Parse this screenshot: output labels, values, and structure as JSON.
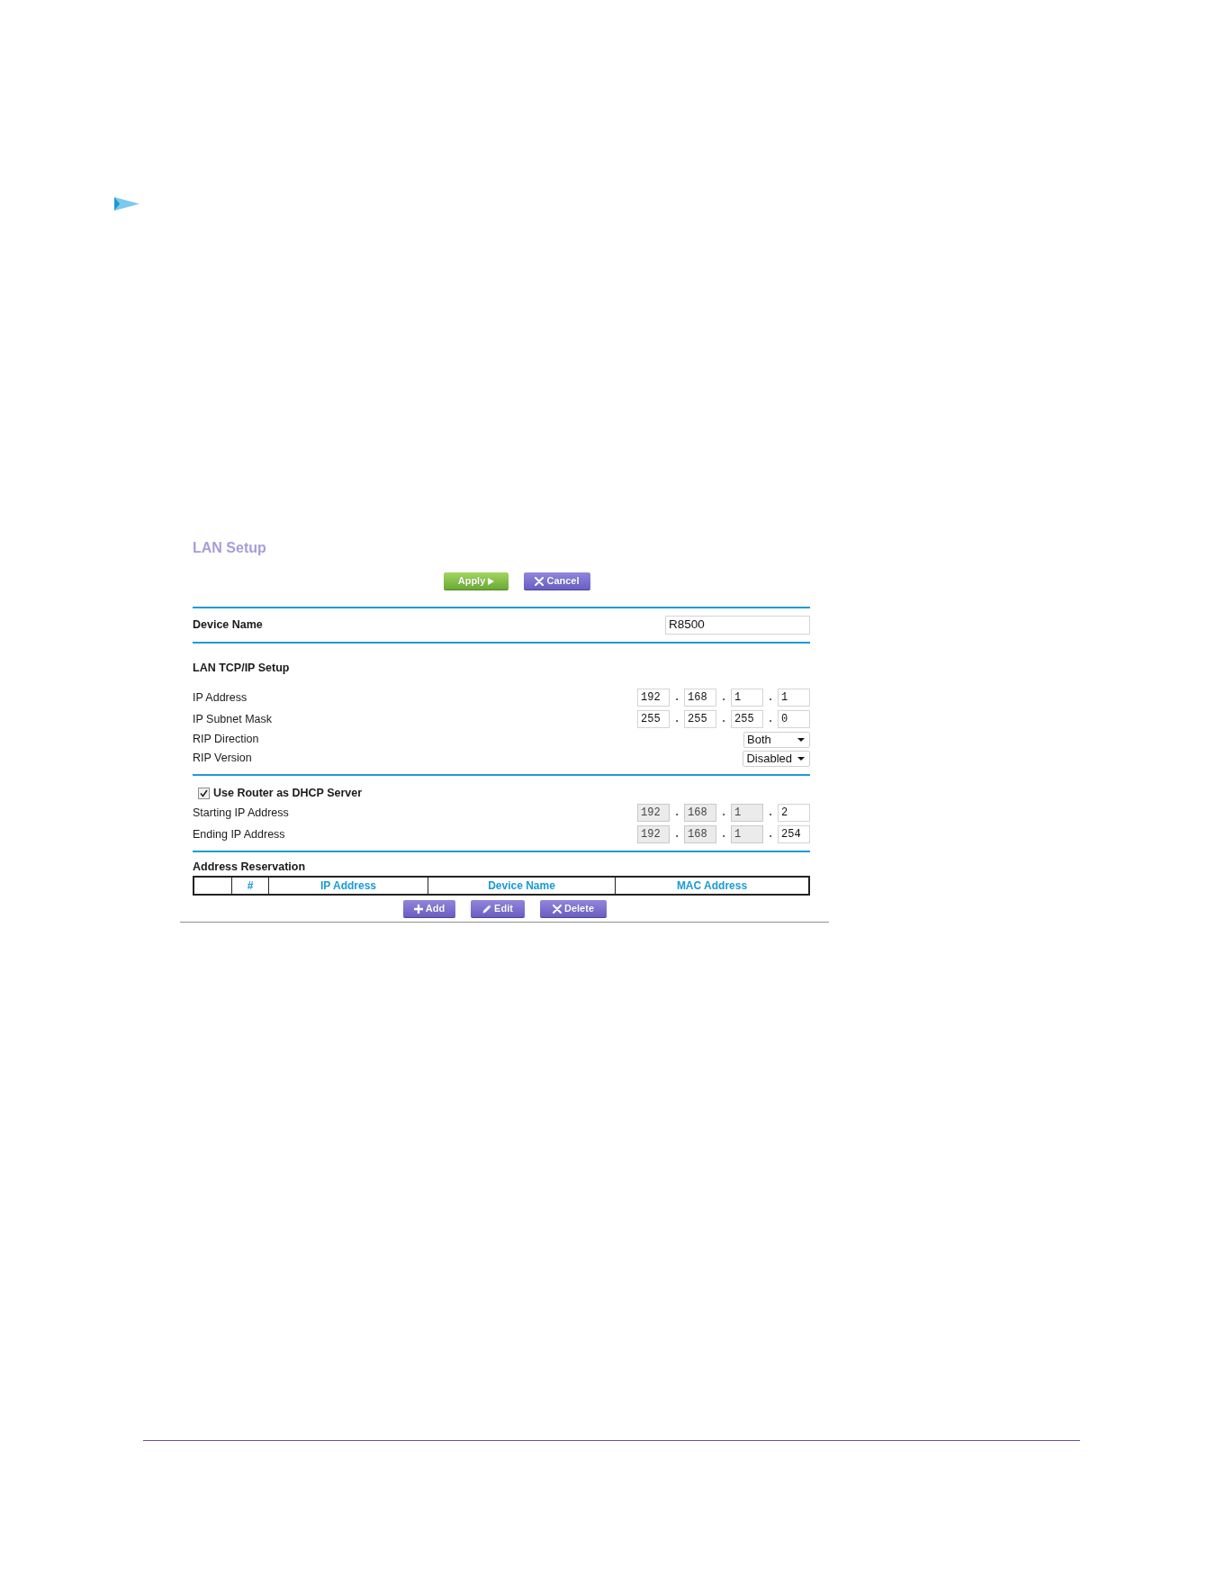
{
  "panel": {
    "title": "LAN Setup",
    "buttons": [
      {
        "kind": "apply",
        "label": "Apply"
      },
      {
        "kind": "cancel",
        "label": "Cancel"
      }
    ]
  },
  "device_name": {
    "label": "Device Name",
    "value": "R8500"
  },
  "lan_tcpip_setup": {
    "heading": "LAN TCP/IP Setup",
    "rows": [
      {
        "kind": "ip",
        "label": "IP Address",
        "separators": [
          ".",
          ".",
          "."
        ],
        "octets": [
          {
            "value": "192",
            "disabled": false
          },
          {
            "value": "168",
            "disabled": false
          },
          {
            "value": "1",
            "disabled": false
          },
          {
            "value": "1",
            "disabled": false
          }
        ]
      },
      {
        "kind": "ip",
        "label": "IP Subnet Mask",
        "separators": [
          ".",
          ".",
          "."
        ],
        "octets": [
          {
            "value": "255",
            "disabled": false
          },
          {
            "value": "255",
            "disabled": false
          },
          {
            "value": "255",
            "disabled": false
          },
          {
            "value": "0",
            "disabled": false
          }
        ]
      },
      {
        "kind": "select",
        "label": "RIP Direction",
        "value": "Both"
      },
      {
        "kind": "select",
        "label": "RIP Version",
        "value": "Disabled"
      }
    ]
  },
  "dhcp_server": {
    "label": "Use Router as DHCP Server",
    "checked": true,
    "rows": [
      {
        "kind": "ip",
        "label": "Starting IP Address",
        "separators": [
          ".",
          ".",
          "."
        ],
        "octets": [
          {
            "value": "192",
            "disabled": true
          },
          {
            "value": "168",
            "disabled": true
          },
          {
            "value": "1",
            "disabled": true
          },
          {
            "value": "2",
            "disabled": false
          }
        ]
      },
      {
        "kind": "ip",
        "label": "Ending IP Address",
        "separators": [
          ".",
          ".",
          "."
        ],
        "octets": [
          {
            "value": "192",
            "disabled": true
          },
          {
            "value": "168",
            "disabled": true
          },
          {
            "value": "1",
            "disabled": true
          },
          {
            "value": "254",
            "disabled": false
          }
        ]
      }
    ]
  },
  "address_reservation": {
    "heading": "Address Reservation",
    "columns": [
      "#",
      "IP Address",
      "Device Name",
      "MAC Address"
    ],
    "buttons": [
      {
        "kind": "add",
        "label": "Add"
      },
      {
        "kind": "edit",
        "label": "Edit"
      },
      {
        "kind": "delete",
        "label": "Delete"
      }
    ]
  }
}
